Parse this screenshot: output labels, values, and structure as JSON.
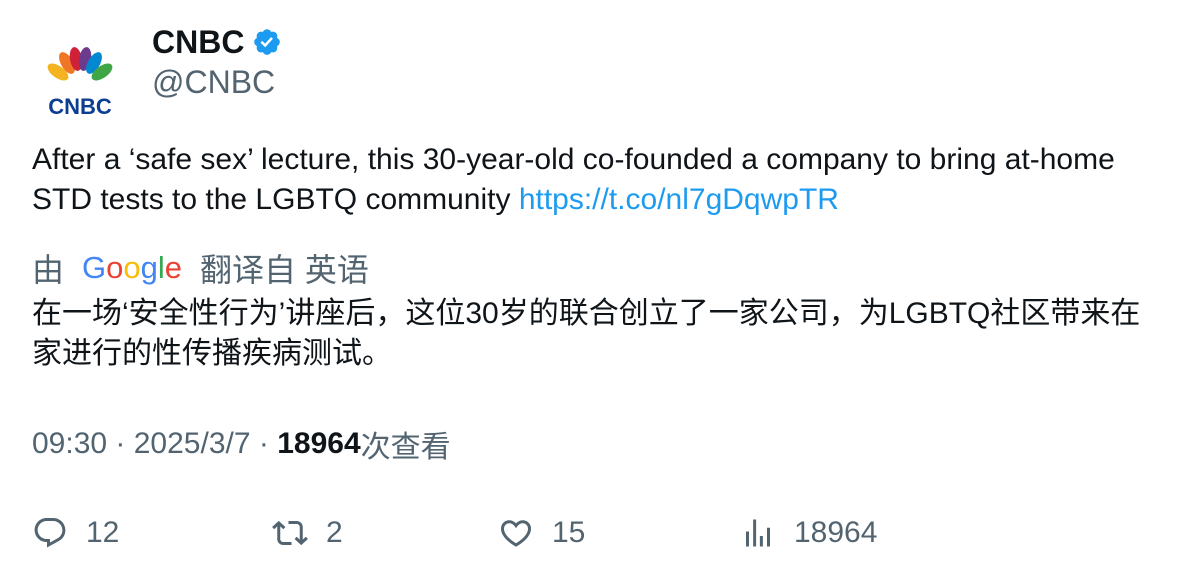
{
  "author": {
    "display_name": "CNBC",
    "handle": "@CNBC",
    "avatar_text": "CNBC",
    "verified_color": "#1d9bf0"
  },
  "tweet": {
    "text": "After a ‘safe sex’ lecture, this 30-year-old co-founded a company to bring at-home STD tests to the LGBTQ community ",
    "link": "https://t.co/nl7gDqwpTR"
  },
  "translation": {
    "prefix": "由",
    "provider": "Google",
    "suffix": "翻译自 英语",
    "text": "在一场‘安全性行为’讲座后，这位30岁的联合创立了一家公司，为LGBTQ社区带来在家进行的性传播疾病测试。"
  },
  "meta": {
    "time": "09:30",
    "sep1": " · ",
    "date": "2025/3/7",
    "sep2": " · ",
    "views": "18964",
    "views_label": "次查看"
  },
  "actions": {
    "replies": "12",
    "retweets": "2",
    "likes": "15",
    "views": "18964"
  },
  "colors": {
    "text": "#0f1419",
    "secondary": "#536471",
    "link": "#1d9bf0"
  }
}
